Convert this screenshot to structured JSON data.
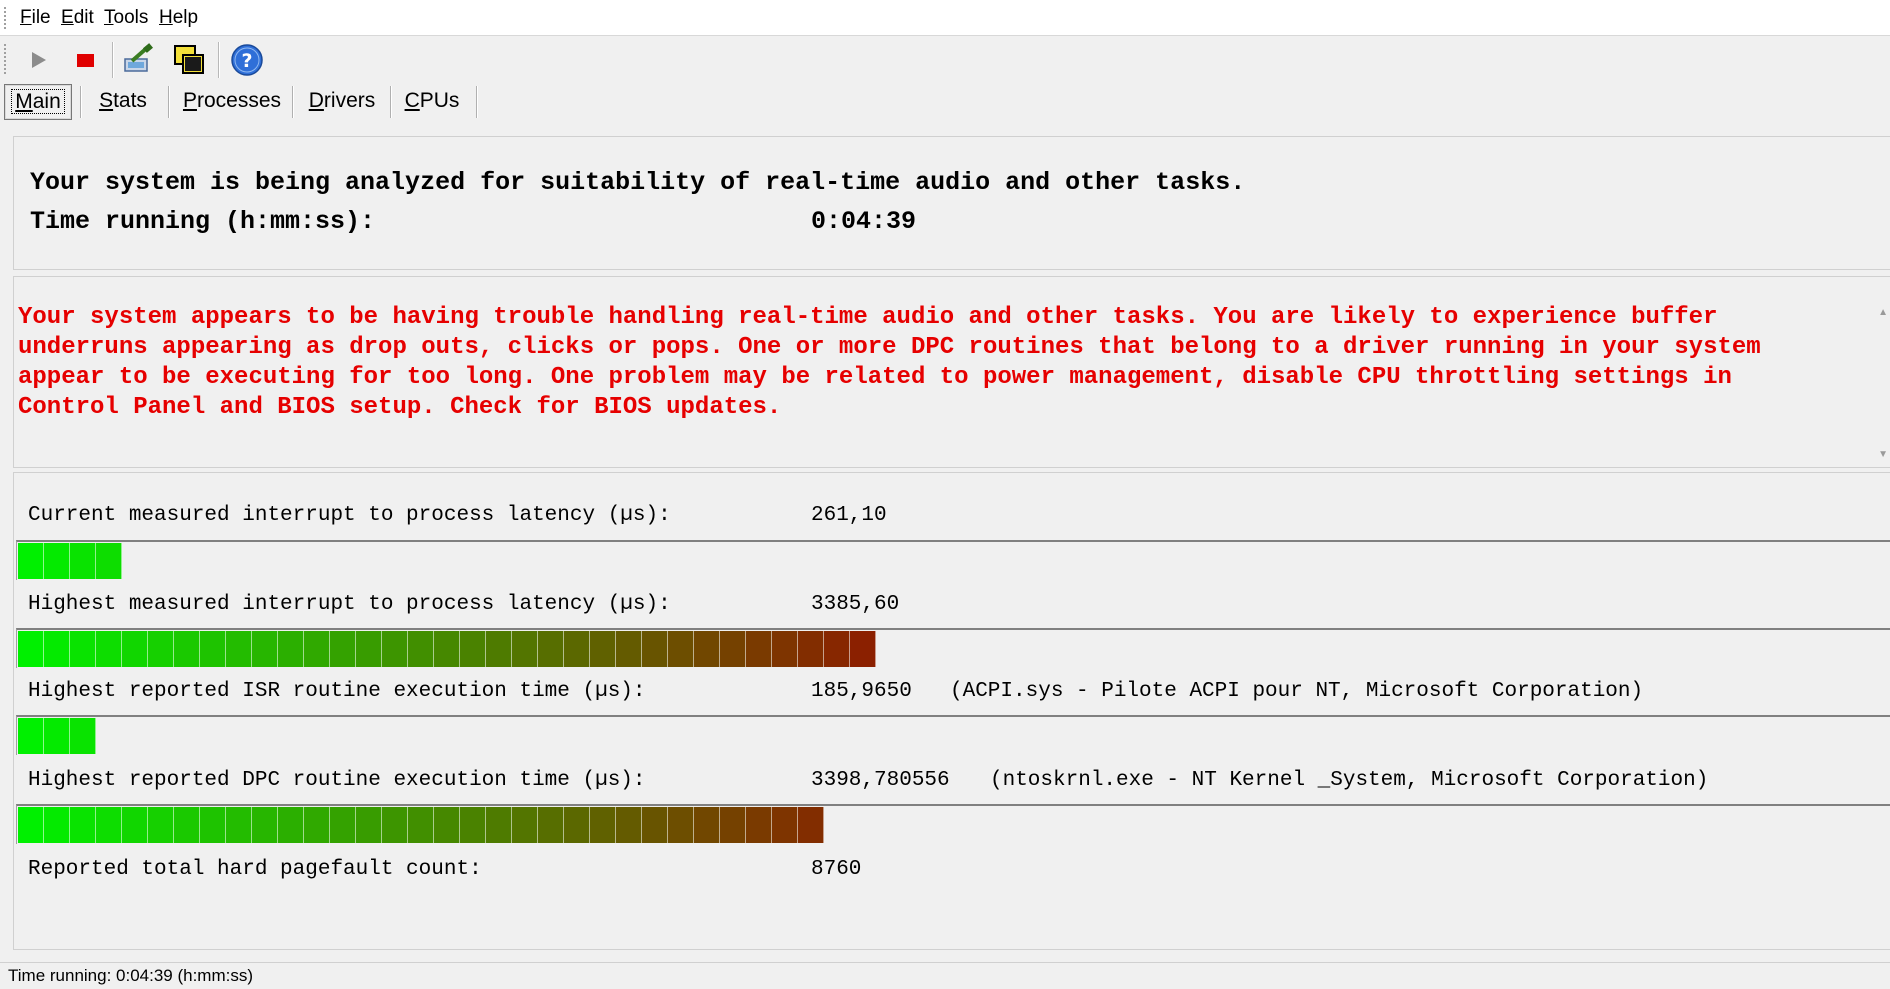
{
  "menu": [
    {
      "accel": "F",
      "rest": "ile"
    },
    {
      "accel": "E",
      "rest": "dit"
    },
    {
      "accel": "T",
      "rest": "ools"
    },
    {
      "accel": "H",
      "rest": "elp"
    }
  ],
  "toolbar": {
    "icons": [
      "play-icon",
      "stop-icon",
      "analyze-icon",
      "windows-icon",
      "help-icon"
    ],
    "colors": {
      "stop": "#e00000",
      "help": "#2f6fd8"
    }
  },
  "tabs": [
    {
      "accel": "M",
      "rest": "ain",
      "active": true
    },
    {
      "accel": "S",
      "rest": "tats",
      "active": false
    },
    {
      "accel": "P",
      "rest": "rocesses",
      "active": false
    },
    {
      "accel": "D",
      "rest": "rivers",
      "active": false
    },
    {
      "accel": "C",
      "rest": "PUs",
      "active": false
    }
  ],
  "summary": {
    "headline": "Your system is being analyzed for suitability of real-time audio and other tasks.",
    "time_label": "Time running (h:mm:ss):",
    "time_value": "0:04:39"
  },
  "warning": {
    "text": "Your system appears to be having trouble handling real-time audio and other tasks. You are likely to experience buffer\nunderruns appearing as drop outs, clicks or pops. One or more DPC routines that belong to a driver running in your system\nappear to be executing for too long. One problem may be related to power management, disable CPU throttling settings in\nControl Panel and BIOS setup. Check for BIOS updates.",
    "color": "#e60000"
  },
  "metrics": {
    "current_latency": {
      "label": "Current measured interrupt to process latency (µs):",
      "value": "261,10",
      "segments_filled": 4
    },
    "highest_latency": {
      "label": "Highest measured interrupt to process latency (µs):",
      "value": "3385,60",
      "segments_filled": 33
    },
    "isr": {
      "label": "Highest reported ISR routine execution time (µs):",
      "value": "185,9650",
      "detail": "(ACPI.sys - Pilote ACPI pour NT, Microsoft Corporation)",
      "segments_filled": 3
    },
    "dpc": {
      "label": "Highest reported DPC routine execution time (µs):",
      "value": "3398,780556",
      "detail": "(ntoskrnl.exe - NT Kernel _System, Microsoft Corporation)",
      "segments_filled": 31
    },
    "pagefault": {
      "label": "Reported total hard pagefault count:",
      "value": "8760"
    },
    "bar_colors": {
      "start": "#00f000",
      "end": "#8b2000"
    }
  },
  "statusbar": {
    "text": "Time running: 0:04:39  (h:mm:ss)"
  }
}
